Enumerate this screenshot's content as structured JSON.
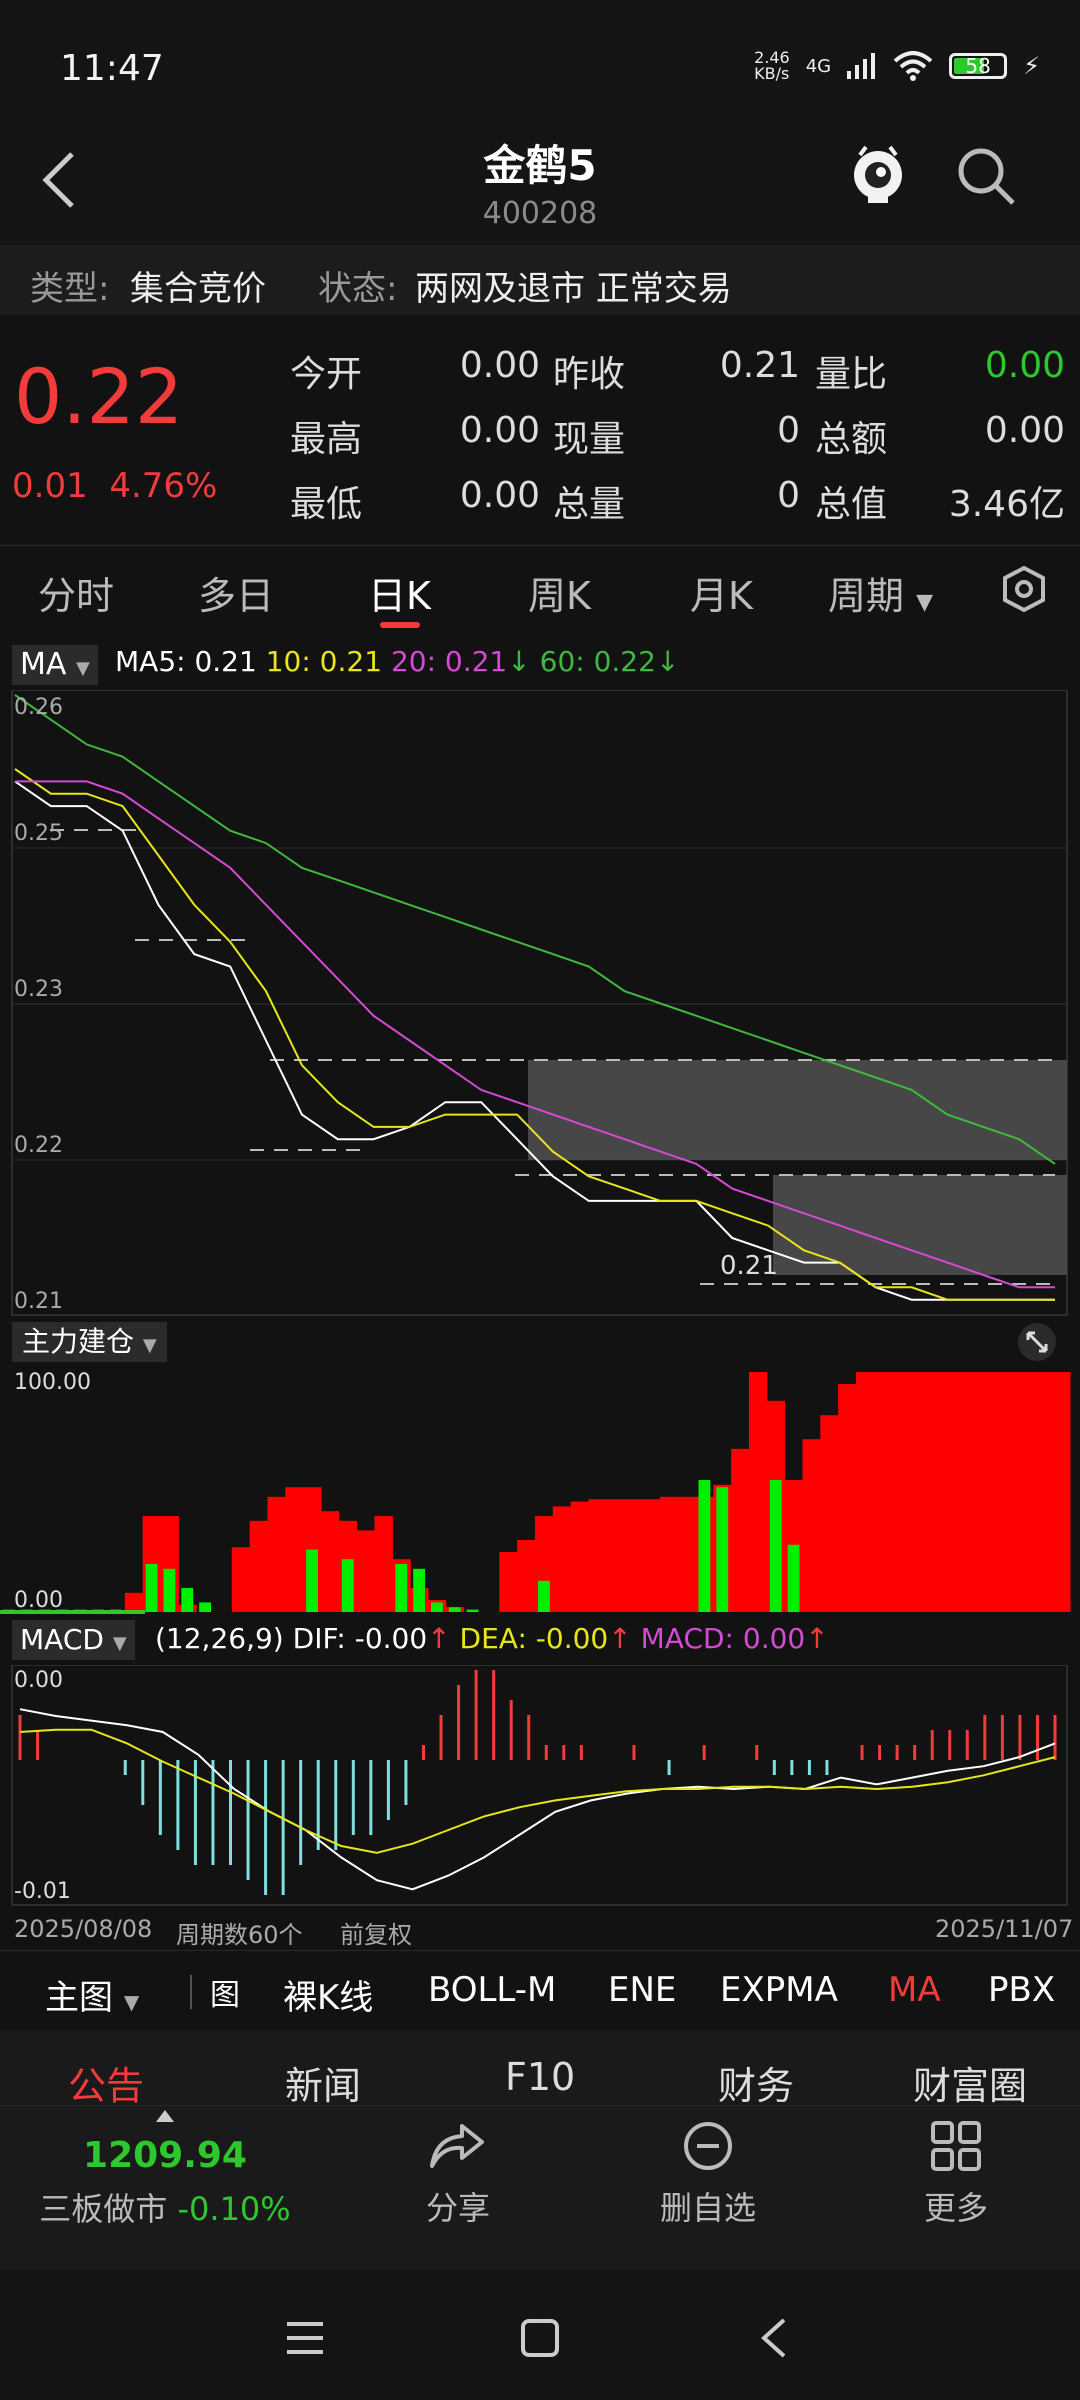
{
  "status_bar": {
    "time": "11:47",
    "net_speed": "2.46\nKB/s",
    "net_type": "4G",
    "battery": "58"
  },
  "header": {
    "title": "金鹤5",
    "code": "400208"
  },
  "info": {
    "type_label": "类型:",
    "type_value": "集合竞价",
    "state_label": "状态:",
    "state_value": "两网及退市 正常交易"
  },
  "quote": {
    "price": "0.22",
    "change": "0.01",
    "change_pct": "4.76%",
    "rows": [
      [
        {
          "l": "今开",
          "v": "0.00"
        },
        {
          "l": "昨收",
          "v": "0.21"
        },
        {
          "l": "量比",
          "v": "0.00"
        }
      ],
      [
        {
          "l": "最高",
          "v": "0.00"
        },
        {
          "l": "现量",
          "v": "0"
        },
        {
          "l": "总额",
          "v": "0.00"
        }
      ],
      [
        {
          "l": "最低",
          "v": "0.00"
        },
        {
          "l": "总量",
          "v": "0"
        },
        {
          "l": "总值",
          "v": "3.46亿"
        }
      ]
    ]
  },
  "tabs": [
    "分时",
    "多日",
    "日K",
    "周K",
    "月K",
    "周期"
  ],
  "ma_legend": {
    "btn": "MA",
    "ma5": "MA5: 0.21",
    "ma10": "10: 0.21",
    "ma20": "20: 0.21",
    "ma60": "60: 0.22"
  },
  "axis": {
    "y0": "0.26",
    "y1": "0.25",
    "y2": "0.23",
    "y3": "0.22",
    "y4": "0.21",
    "flag": "0.21"
  },
  "flow": {
    "btn": "主力建仓",
    "top": "100.00",
    "bottom": "0.00"
  },
  "macd": {
    "btn": "MACD",
    "params": "(12,26,9)",
    "dif": "DIF: -0.00",
    "dea": "DEA: -0.00",
    "macd": "MACD: 0.00",
    "top": "0.00",
    "bottom": "-0.01"
  },
  "date_axis": {
    "start": "2025/08/08",
    "count": "周期数60个",
    "adj": "前复权",
    "end": "2025/11/07"
  },
  "main_nav": {
    "main": "主图",
    "icon": "图",
    "items": [
      "裸K线",
      "BOLL-M",
      "ENE",
      "EXPMA",
      "MA",
      "PBX"
    ]
  },
  "sub_nav": [
    "公告",
    "新闻",
    "F10",
    "财务",
    "财富圈"
  ],
  "bottom_bar": {
    "index_value": "1209.94",
    "index_name": "三板做市",
    "index_change": "-0.10%",
    "share": "分享",
    "remove": "删自选",
    "more": "更多"
  },
  "colors": {
    "up": "#f23b3b",
    "down": "#2ec82e",
    "ma5": "#ffffff",
    "ma10": "#e6e619",
    "ma20": "#d44ad4",
    "ma60": "#3fb83f",
    "dif": "#ffffff",
    "dea": "#e6e619"
  },
  "chart_data": [
    {
      "type": "line",
      "x": [
        "2025/08/08",
        "2025/11/07"
      ],
      "ylim": [
        0.21,
        0.26
      ],
      "series": [
        {
          "name": "MA5",
          "values": [
            0.253,
            0.251,
            0.251,
            0.249,
            0.243,
            0.239,
            0.238,
            0.232,
            0.226,
            0.224,
            0.224,
            0.225,
            0.227,
            0.227,
            0.224,
            0.221,
            0.219,
            0.219,
            0.219,
            0.219,
            0.216,
            0.215,
            0.214,
            0.214,
            0.212,
            0.211,
            0.211,
            0.211,
            0.211,
            0.211
          ]
        },
        {
          "name": "10",
          "values": [
            0.254,
            0.252,
            0.252,
            0.251,
            0.247,
            0.243,
            0.24,
            0.236,
            0.23,
            0.227,
            0.225,
            0.225,
            0.226,
            0.226,
            0.226,
            0.223,
            0.221,
            0.22,
            0.219,
            0.219,
            0.218,
            0.217,
            0.215,
            0.214,
            0.212,
            0.212,
            0.211,
            0.211,
            0.211,
            0.211
          ]
        },
        {
          "name": "20",
          "values": [
            0.253,
            0.253,
            0.253,
            0.252,
            0.25,
            0.248,
            0.246,
            0.243,
            0.24,
            0.237,
            0.234,
            0.232,
            0.23,
            0.228,
            0.227,
            0.226,
            0.225,
            0.224,
            0.223,
            0.222,
            0.22,
            0.219,
            0.218,
            0.217,
            0.216,
            0.215,
            0.214,
            0.213,
            0.212,
            0.212
          ]
        },
        {
          "name": "60",
          "values": [
            0.26,
            0.258,
            0.256,
            0.255,
            0.253,
            0.251,
            0.249,
            0.248,
            0.246,
            0.245,
            0.244,
            0.243,
            0.242,
            0.241,
            0.24,
            0.239,
            0.238,
            0.236,
            0.235,
            0.234,
            0.233,
            0.232,
            0.231,
            0.23,
            0.229,
            0.228,
            0.226,
            0.225,
            0.224,
            0.222
          ]
        }
      ]
    },
    {
      "type": "bar",
      "title": "主力建仓",
      "ylim": [
        0,
        100
      ],
      "series": [
        {
          "name": "red",
          "values": [
            0,
            0,
            0,
            0,
            0,
            0,
            0,
            0,
            0,
            0,
            0,
            0,
            0,
            0,
            0,
            0,
            0,
            0,
            0,
            0,
            0,
            0,
            0,
            0,
            0,
            0,
            0,
            0,
            0,
            0,
            0,
            0,
            0,
            0,
            0,
            0,
            0,
            0,
            0,
            0,
            0,
            0,
            0,
            0,
            0,
            0,
            0,
            0,
            0,
            0,
            0,
            0,
            0,
            0,
            0,
            0,
            0,
            0,
            0,
            0
          ]
        }
      ],
      "red_values": [
        0,
        0,
        0,
        0,
        0,
        0,
        0,
        8,
        40,
        40,
        3,
        0,
        0,
        27,
        38,
        48,
        52,
        52,
        42,
        38,
        34,
        40,
        22,
        10,
        5,
        2,
        0,
        0,
        25,
        30,
        40,
        44,
        46,
        47,
        47,
        47,
        47,
        48,
        48,
        48,
        53,
        68,
        100,
        88,
        55,
        72,
        82,
        95,
        100,
        100,
        100,
        100,
        100,
        100,
        100,
        100,
        100,
        100,
        100,
        100
      ],
      "green_values": [
        1,
        1,
        1,
        1,
        1,
        1,
        1,
        0,
        20,
        18,
        10,
        4,
        0,
        0,
        0,
        0,
        0,
        26,
        0,
        22,
        0,
        0,
        20,
        18,
        4,
        2,
        1,
        0,
        0,
        0,
        13,
        0,
        0,
        0,
        0,
        0,
        0,
        0,
        0,
        55,
        52,
        0,
        0,
        55,
        28,
        0,
        0,
        0,
        0,
        0,
        0,
        0,
        0,
        0,
        0,
        0,
        0,
        0,
        0,
        0
      ]
    },
    {
      "type": "bar",
      "title": "MACD",
      "ylim": [
        -0.01,
        0.0
      ],
      "values": [
        0.3,
        0.2,
        0.0,
        0.0,
        0.0,
        0.0,
        -0.1,
        -0.3,
        -0.5,
        -0.6,
        -0.7,
        -0.7,
        -0.7,
        -0.8,
        -0.9,
        -0.9,
        -0.7,
        -0.6,
        -0.6,
        -0.5,
        -0.5,
        -0.4,
        -0.3,
        0.1,
        0.3,
        0.5,
        0.6,
        0.6,
        0.4,
        0.3,
        0.1,
        0.1,
        0.1,
        0.0,
        0.0,
        0.1,
        0.0,
        -0.1,
        0.0,
        0.1,
        0.0,
        0.0,
        0.1,
        -0.1,
        -0.1,
        -0.1,
        -0.1,
        0.0,
        0.1,
        0.1,
        0.1,
        0.1,
        0.2,
        0.2,
        0.2,
        0.3,
        0.3,
        0.3,
        0.3,
        0.3
      ],
      "dif": [
        -0.0015,
        -0.0018,
        -0.002,
        -0.0022,
        -0.0025,
        -0.0035,
        -0.005,
        -0.006,
        -0.0068,
        -0.008,
        -0.009,
        -0.0094,
        -0.0088,
        -0.008,
        -0.007,
        -0.006,
        -0.0055,
        -0.0052,
        -0.005,
        -0.0049,
        -0.005,
        -0.0049,
        -0.005,
        -0.0045,
        -0.0048,
        -0.0045,
        -0.0042,
        -0.004,
        -0.0036,
        -0.003
      ],
      "dea": [
        -0.0025,
        -0.0024,
        -0.0024,
        -0.003,
        -0.0038,
        -0.0045,
        -0.0052,
        -0.006,
        -0.0068,
        -0.0075,
        -0.0078,
        -0.0074,
        -0.0068,
        -0.0062,
        -0.0058,
        -0.0055,
        -0.0053,
        -0.0051,
        -0.005,
        -0.005,
        -0.0049,
        -0.0049,
        -0.005,
        -0.0049,
        -0.005,
        -0.0049,
        -0.0047,
        -0.0044,
        -0.004,
        -0.0036
      ]
    }
  ]
}
